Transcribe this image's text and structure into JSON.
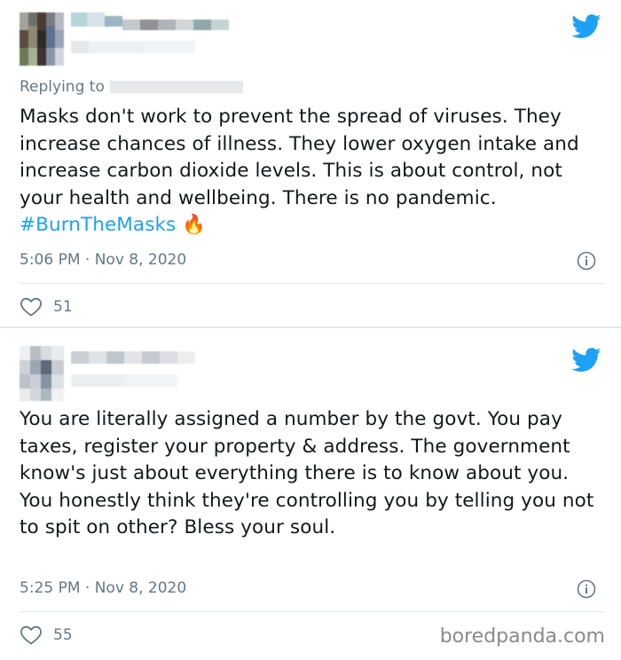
{
  "tweets": [
    {
      "replying_label": "Replying to",
      "text_main": "Masks don't work to prevent the spread of viruses. They increase chances of illness. They lower oxygen intake and increase carbon dioxide levels. This is about control, not your health and wellbeing. There is no pandemic.",
      "hashtag": "#BurnTheMasks",
      "emoji": "🔥",
      "timestamp": "5:06 PM · Nov 8, 2020",
      "likes": "51"
    },
    {
      "text_main": "You are literally assigned a number by the govt. You pay taxes, register your property & address. The government know's just about everything there is to know about you. You honestly think they're controlling you by telling you not to spit on other? Bless your soul.",
      "timestamp": "5:25 PM · Nov 8, 2020",
      "likes": "55"
    }
  ],
  "watermark": "boredpanda.com",
  "colors": {
    "accent": "#1da1f2",
    "muted": "#657786",
    "text": "#14171a"
  },
  "icons": [
    "twitter-bird-icon",
    "info-icon",
    "heart-icon"
  ]
}
